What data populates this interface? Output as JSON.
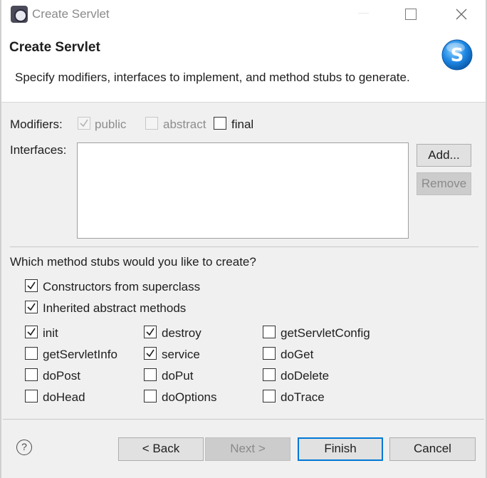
{
  "window": {
    "title": "Create Servlet",
    "icon": "eclipse-icon"
  },
  "header": {
    "title": "Create Servlet",
    "description": "Specify modifiers, interfaces to implement, and method stubs to generate.",
    "logo_letter": "S"
  },
  "modifiers": {
    "label": "Modifiers:",
    "public": {
      "label": "public",
      "checked": true,
      "enabled": false
    },
    "abstract": {
      "label": "abstract",
      "checked": false,
      "enabled": false
    },
    "final": {
      "label": "final",
      "checked": false,
      "enabled": true
    }
  },
  "interfaces": {
    "label": "Interfaces:",
    "items": [],
    "add_label": "Add...",
    "remove_label": "Remove"
  },
  "stubs": {
    "question": "Which method stubs would you like to create?",
    "constructors": {
      "label": "Constructors from superclass",
      "checked": true
    },
    "inherited": {
      "label": "Inherited abstract methods",
      "checked": true
    },
    "methods": [
      {
        "label": "init",
        "checked": true
      },
      {
        "label": "destroy",
        "checked": true
      },
      {
        "label": "getServletConfig",
        "checked": false
      },
      {
        "label": "getServletInfo",
        "checked": false
      },
      {
        "label": "service",
        "checked": true
      },
      {
        "label": "doGet",
        "checked": false
      },
      {
        "label": "doPost",
        "checked": false
      },
      {
        "label": "doPut",
        "checked": false
      },
      {
        "label": "doDelete",
        "checked": false
      },
      {
        "label": "doHead",
        "checked": false
      },
      {
        "label": "doOptions",
        "checked": false
      },
      {
        "label": "doTrace",
        "checked": false
      }
    ]
  },
  "footer": {
    "help": "?",
    "back_label": "< Back",
    "next_label": "Next >",
    "finish_label": "Finish",
    "cancel_label": "Cancel"
  },
  "colors": {
    "accent": "#0078d7",
    "dialog_bg": "#f0f0f0",
    "logo_blue": "#1e88e5"
  }
}
